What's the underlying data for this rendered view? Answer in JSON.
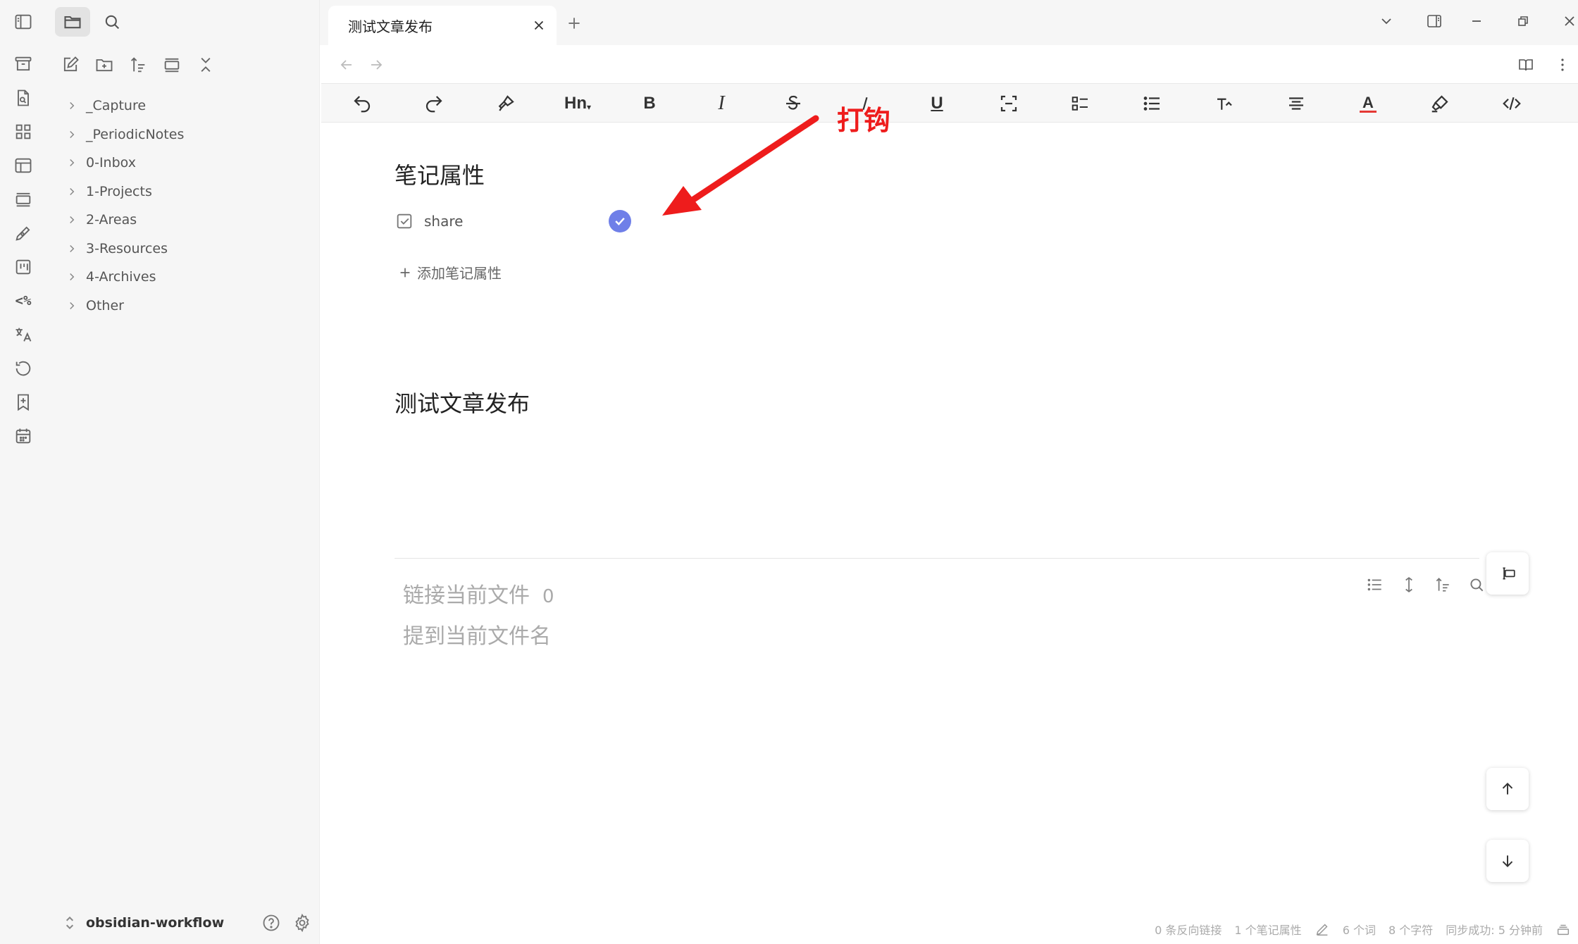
{
  "tab": {
    "title": "测试文章发布"
  },
  "sidebar": {
    "folders": [
      {
        "label": "_Capture"
      },
      {
        "label": "_PeriodicNotes"
      },
      {
        "label": "0-Inbox"
      },
      {
        "label": "1-Projects"
      },
      {
        "label": "2-Areas"
      },
      {
        "label": "3-Resources"
      },
      {
        "label": "4-Archives"
      },
      {
        "label": "Other"
      }
    ],
    "vault_name": "obsidian-workflow",
    "ribbon_text_icon": "<%"
  },
  "toolbar": {
    "heading_label": "Hn",
    "bold_label": "B",
    "italic_label": "I",
    "underline_label": "U",
    "font_color_label": "A",
    "font_color": "#e53935"
  },
  "properties": {
    "title": "笔记属性",
    "items": [
      {
        "name": "share",
        "type": "checkbox",
        "checked": true
      }
    ],
    "add_label": "添加笔记属性"
  },
  "document": {
    "heading": "测试文章发布"
  },
  "backlinks": {
    "linked_label": "链接当前文件",
    "linked_count": "0",
    "unlinked_label": "提到当前文件名"
  },
  "annotation": {
    "label": "打钩",
    "color": "#ee1c1c"
  },
  "statusbar": {
    "backlinks": "0 条反向链接",
    "properties": "1 个笔记属性",
    "words": "6 个词",
    "chars": "8 个字符",
    "sync": "同步成功: 5 分钟前"
  },
  "colors": {
    "accent": "#6f7fe8",
    "sidebar_bg": "#f6f6f6"
  }
}
